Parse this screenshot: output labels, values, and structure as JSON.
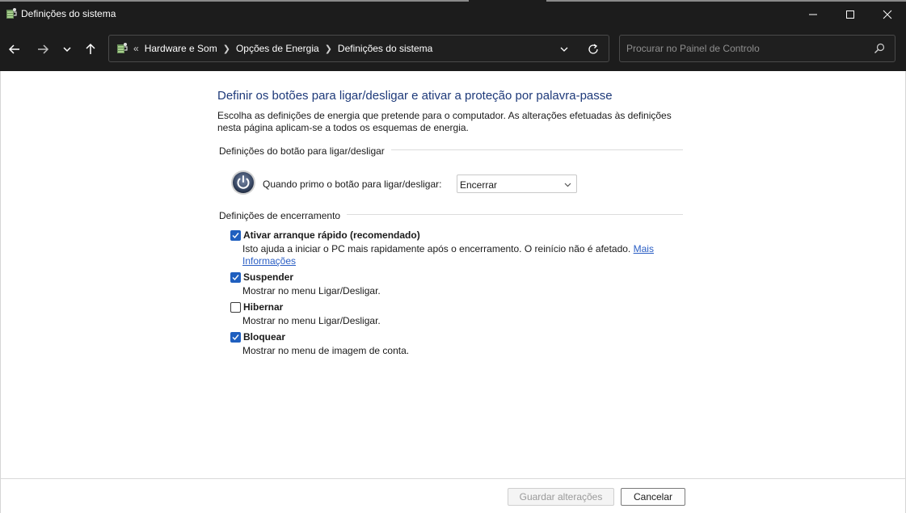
{
  "window": {
    "title": "Definições do sistema",
    "icon": "power-options-icon",
    "controls": {
      "minimize": "minimize-icon",
      "maximize": "maximize-icon",
      "close": "close-icon"
    }
  },
  "nav": {
    "back": "arrow-left-icon",
    "forward": "arrow-right-icon",
    "recent": "chevron-down-icon",
    "up": "arrow-up-icon"
  },
  "address": {
    "overflow": "«",
    "crumbs": [
      "Hardware e Som",
      "Opções de Energia",
      "Definições do sistema"
    ]
  },
  "search": {
    "placeholder": "Procurar no Painel de Controlo",
    "value": ""
  },
  "main": {
    "heading": "Definir os botões para ligar/desligar e ativar a proteção por palavra-passe",
    "description": "Escolha as definições de energia que pretende para o computador. As alterações efetuadas às definições nesta página aplicam-se a todos os esquemas de energia.",
    "power_section": {
      "title": "Definições do botão para ligar/desligar",
      "label": "Quando primo o botão para ligar/desligar:",
      "selected": "Encerrar"
    },
    "shutdown_section": {
      "title": "Definições de encerramento",
      "options": [
        {
          "label": "Ativar arranque rápido (recomendado)",
          "checked": true,
          "description": "Isto ajuda a iniciar o PC mais rapidamente após o encerramento. O reinício não é afetado.",
          "link": "Mais Informações"
        },
        {
          "label": "Suspender",
          "checked": true,
          "description": "Mostrar no menu Ligar/Desligar."
        },
        {
          "label": "Hibernar",
          "checked": false,
          "description": "Mostrar no menu Ligar/Desligar."
        },
        {
          "label": "Bloquear",
          "checked": true,
          "description": "Mostrar no menu de imagem de conta."
        }
      ]
    }
  },
  "footer": {
    "save": "Guardar alterações",
    "cancel": "Cancelar"
  },
  "colors": {
    "heading": "#1e3a7a",
    "checkbox": "#1f5fbf",
    "link": "#2a5ec4",
    "chrome": "#1c1c1c"
  }
}
